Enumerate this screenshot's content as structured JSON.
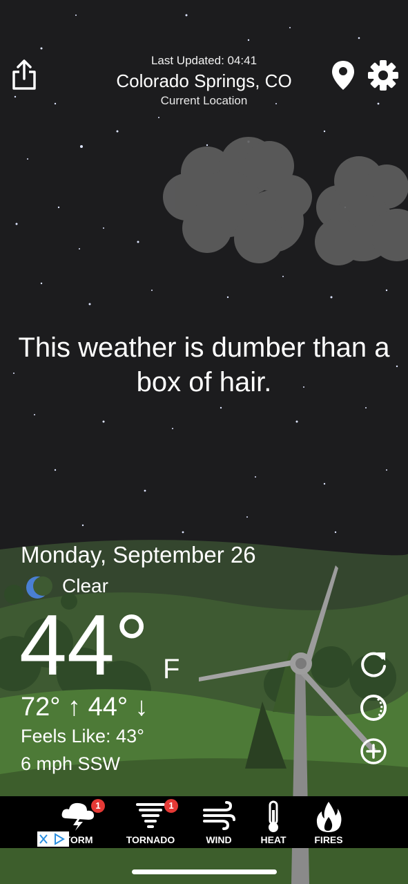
{
  "header": {
    "last_updated": "Last Updated: 04:41",
    "city": "Colorado Springs, CO",
    "current_location": "Current Location"
  },
  "phrase": "This weather is dumber than a box of hair.",
  "weather": {
    "date": "Monday, September 26",
    "condition": "Clear",
    "condition_icon": "moon-icon",
    "temperature": "44°",
    "unit": "F",
    "hi_lo": "72° ↑ 44° ↓",
    "feels_like": "Feels Like: 43°",
    "wind": "6 mph SSW"
  },
  "side_buttons": [
    "refresh-icon",
    "radar-icon",
    "add-icon"
  ],
  "tabs": [
    {
      "label": "TORM",
      "icon": "storm-icon",
      "badge": "1"
    },
    {
      "label": "TORNADO",
      "icon": "tornado-icon",
      "badge": "1"
    },
    {
      "label": "WIND",
      "icon": "wind-icon"
    },
    {
      "label": "HEAT",
      "icon": "thermometer-icon"
    },
    {
      "label": "FIRES",
      "icon": "fire-icon"
    }
  ],
  "colors": {
    "sky": "#1c1c1e",
    "landscape": "#3d5a2e",
    "tab_bar": "#000000",
    "badge": "#e53935",
    "moon": "#4a7fd4"
  }
}
